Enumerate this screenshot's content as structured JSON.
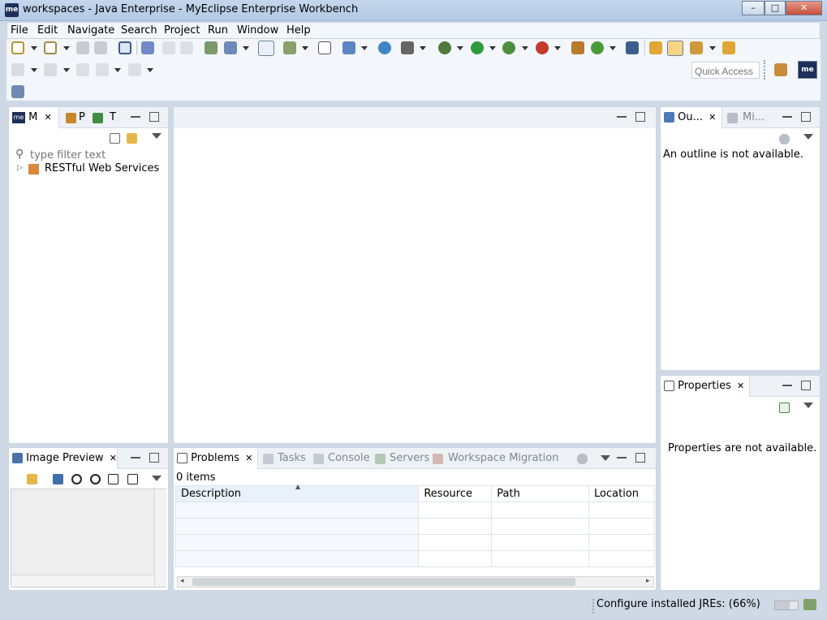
{
  "window": {
    "logo": "me",
    "title": "workspaces - Java Enterprise - MyEclipse Enterprise Workbench",
    "min_glyph": "–",
    "max_glyph": "□",
    "close_glyph": "✕"
  },
  "menu": [
    "File",
    "Edit",
    "Navigate",
    "Search",
    "Project",
    "Run",
    "Window",
    "Help"
  ],
  "quick_access": {
    "placeholder": "Quick Access"
  },
  "explorer": {
    "tabs": [
      "M",
      "P",
      "T"
    ],
    "filter_placeholder": "type filter text",
    "tree": [
      {
        "label": "RESTful Web Services"
      }
    ]
  },
  "outline": {
    "tabs": [
      "Ou...",
      "Mi..."
    ],
    "message": "An outline is not available."
  },
  "properties": {
    "tab": "Properties",
    "message": "Properties are not available."
  },
  "image_preview": {
    "tab": "Image Preview"
  },
  "problems": {
    "tabs": [
      "Problems",
      "Tasks",
      "Console",
      "Servers",
      "Workspace Migration"
    ],
    "count": "0 items",
    "columns": [
      "Description",
      "Resource",
      "Path",
      "Location"
    ]
  },
  "status": {
    "progress_text": "Configure installed JREs: (66%)",
    "progress_value": 66
  },
  "colors": {
    "accent": "#1d2f5a",
    "panel_bg": "#cfd9e6"
  }
}
